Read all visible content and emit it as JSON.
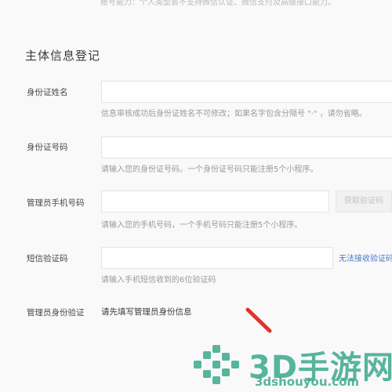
{
  "top_note": "账号能力：个人类型暂不支持微信认证、微信支付及高级接口能力。",
  "section_title": "主体信息登记",
  "fields": {
    "name": {
      "label": "身份证姓名",
      "hint": "信息审核成功后身份证姓名不可修改；如果名字包含分隔号 \"·\" ，请勿省略。"
    },
    "id_number": {
      "label": "身份证号码",
      "hint": "请输入您的身份证号码。一个身份证号码只能注册5个小程序。"
    },
    "phone": {
      "label": "管理员手机号码",
      "hint": "请输入您的手机号码，一个手机号码只能注册5个小程序。",
      "button": "获取验证码"
    },
    "sms_code": {
      "label": "短信验证码",
      "hint": "请输入手机短信收到的6位验证码",
      "link": "无法接收验证码"
    },
    "admin_verify": {
      "label": "管理员身份验证",
      "text": "请先填写管理员身份信息"
    }
  },
  "watermark": {
    "main": "3D手游网",
    "sub": "3dshouyou.com"
  },
  "colors": {
    "link": "#4a78c8",
    "watermark": "#3aaa8c",
    "arrow": "#e0342c"
  }
}
